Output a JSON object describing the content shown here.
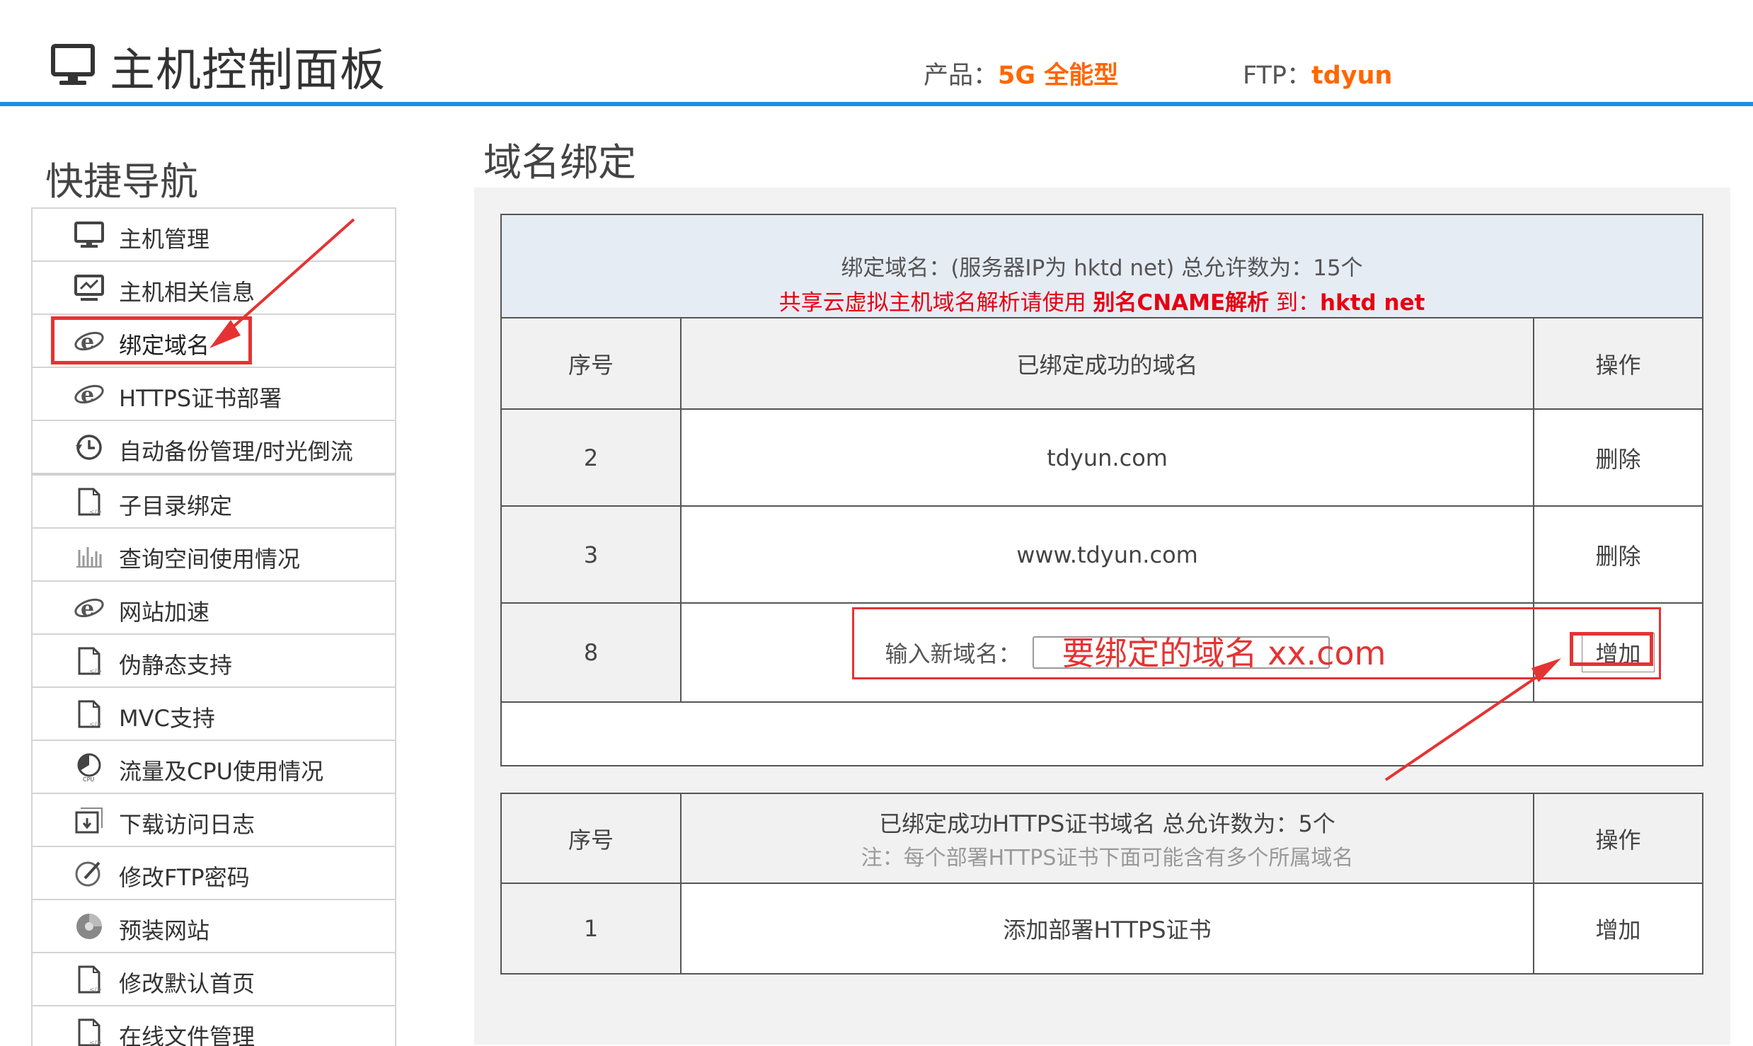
{
  "header": {
    "title": "主机控制面板",
    "product_label": "产品：",
    "product_value": "5G 全能型",
    "ftp_label": "FTP：",
    "ftp_value": "tdyun"
  },
  "sidebar": {
    "title": "快捷导航",
    "items": [
      {
        "label": "主机管理",
        "icon": "monitor-icon"
      },
      {
        "label": "主机相关信息",
        "icon": "monitor-info-icon"
      },
      {
        "label": "绑定域名",
        "icon": "ie-icon"
      },
      {
        "label": "HTTPS证书部署",
        "icon": "ie-icon"
      },
      {
        "label": "自动备份管理/时光倒流",
        "icon": "clock-icon"
      },
      {
        "label": "子目录绑定",
        "icon": "file-icon"
      },
      {
        "label": "查询空间使用情况",
        "icon": "bar-chart-icon"
      },
      {
        "label": "网站加速",
        "icon": "ie-icon"
      },
      {
        "label": "伪静态支持",
        "icon": "file-icon"
      },
      {
        "label": "MVC支持",
        "icon": "file-icon"
      },
      {
        "label": "流量及CPU使用情况",
        "icon": "cpu-pie-icon"
      },
      {
        "label": "下载访问日志",
        "icon": "download-icon"
      },
      {
        "label": "修改FTP密码",
        "icon": "edit-icon"
      },
      {
        "label": "预装网站",
        "icon": "disc-icon"
      },
      {
        "label": "修改默认首页",
        "icon": "file-icon"
      },
      {
        "label": "在线文件管理",
        "icon": "file-icon"
      }
    ]
  },
  "main": {
    "title": "域名绑定",
    "binding_info": {
      "line1": "绑定域名：(服务器IP为 hktd          net)   总允许数为：15个",
      "line2_prefix": "共享云虚拟主机域名解析请使用 ",
      "line2_bold": "别名CNAME解析",
      "line2_mid": " 到：",
      "line2_target": "hktd              net"
    },
    "columns": [
      "序号",
      "已绑定成功的域名",
      "操作"
    ],
    "rows": [
      {
        "index": "2",
        "domain": "tdyun.com",
        "action": "删除"
      },
      {
        "index": "3",
        "domain": "www.tdyun.com",
        "action": "删除"
      }
    ],
    "add_row": {
      "index": "8",
      "label": "输入新域名：",
      "input_value": "要绑定的域名  xx.com",
      "action": "增加"
    },
    "https": {
      "col_index": "序号",
      "col_title": "已绑定成功HTTPS证书域名 总允许数为：5个",
      "col_note": "注：每个部署HTTPS证书下面可能含有多个所属域名",
      "col_action": "操作",
      "row": {
        "index": "1",
        "label": "添加部署HTTPS证书",
        "action": "增加"
      }
    }
  },
  "colors": {
    "accent_blue": "#1b8fe6",
    "highlight_orange": "#ff6600",
    "warning_red": "#e60012",
    "annotation_red": "#e53333"
  }
}
